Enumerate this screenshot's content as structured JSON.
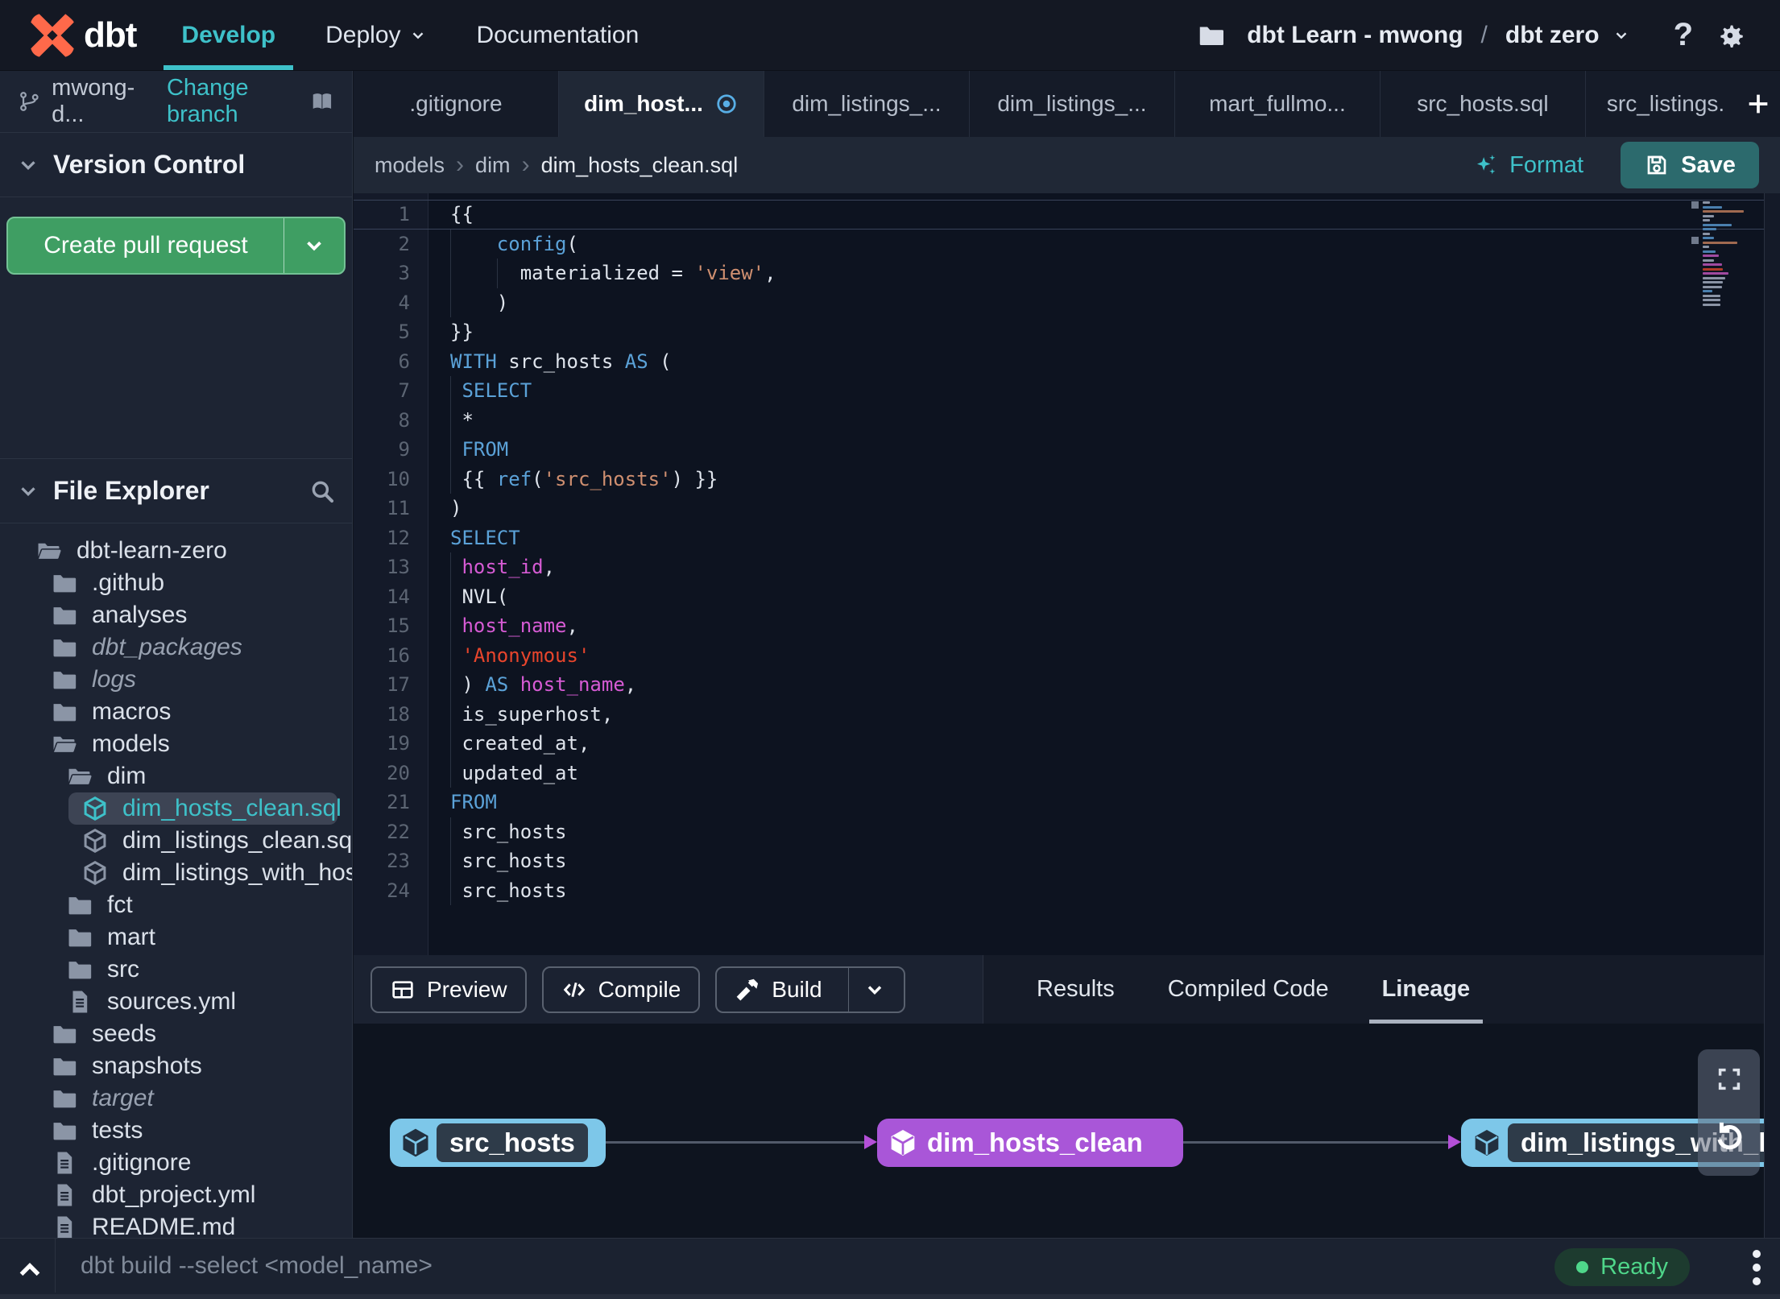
{
  "colors": {
    "bg_nav": "#141823",
    "bg_side": "#1d2433",
    "bg_tabrow": "#151b28",
    "bg_tab_active": "#202836",
    "bg_editor": "#0d1320",
    "bg_gutter": "#141a29",
    "bg_toolbar_left": "#1b2231",
    "bg_toolbar_right": "#151b28",
    "bg_lineage": "#0e141f",
    "bg_status": "#1b2230",
    "border": "#2b3342",
    "teal": "#3ec1c9",
    "green": "#3f9e63",
    "green_border": "#74c295",
    "save": "#2c6a6d",
    "purple": "#a956d8",
    "nodeblue": "#7dc7e9",
    "ready": "#4fd68a",
    "readybg": "#1d3b2f",
    "brand_orange": "#ff694a",
    "blue_dot": "#58aee5",
    "code_keyword": "#5ba2d8",
    "code_ident": "#d65bd4",
    "code_string": "#cf8f70",
    "code_red": "#e8452c",
    "code_text": "#dfe4ec",
    "code_linenum": "#5c6573"
  },
  "nav": {
    "brand": "dbt",
    "items": [
      {
        "label": "Develop",
        "active": true,
        "chevron": false
      },
      {
        "label": "Deploy",
        "active": false,
        "chevron": true
      },
      {
        "label": "Documentation",
        "active": false,
        "chevron": false
      }
    ],
    "project": {
      "folder_label": "dbt Learn - mwong",
      "separator": "/",
      "env_label": "dbt zero"
    },
    "help_label": "?"
  },
  "sidebar": {
    "branch": {
      "name": "mwong-d...",
      "change_link": "Change branch"
    },
    "version_control": {
      "title": "Version Control",
      "pr_button": "Create pull request"
    },
    "file_explorer": {
      "title": "File Explorer",
      "tree": [
        {
          "label": "dbt-learn-zero",
          "level": 0,
          "icon": "folder-open-icon"
        },
        {
          "label": ".github",
          "level": 1,
          "icon": "folder-icon"
        },
        {
          "label": "analyses",
          "level": 1,
          "icon": "folder-icon"
        },
        {
          "label": "dbt_packages",
          "level": 1,
          "icon": "folder-icon",
          "italic": true
        },
        {
          "label": "logs",
          "level": 1,
          "icon": "folder-icon",
          "italic": true
        },
        {
          "label": "macros",
          "level": 1,
          "icon": "folder-icon"
        },
        {
          "label": "models",
          "level": 1,
          "icon": "folder-open-icon"
        },
        {
          "label": "dim",
          "level": 2,
          "icon": "folder-open-icon"
        },
        {
          "label": "dim_hosts_clean.sql",
          "level": 3,
          "icon": "model-icon",
          "selected": true,
          "modified_dot": true
        },
        {
          "label": "dim_listings_clean.sql",
          "level": 3,
          "icon": "model-icon"
        },
        {
          "label": "dim_listings_with_hosts...",
          "level": 3,
          "icon": "model-icon"
        },
        {
          "label": "fct",
          "level": 2,
          "icon": "folder-icon"
        },
        {
          "label": "mart",
          "level": 2,
          "icon": "folder-icon"
        },
        {
          "label": "src",
          "level": 2,
          "icon": "folder-icon"
        },
        {
          "label": "sources.yml",
          "level": 2,
          "icon": "file-icon"
        },
        {
          "label": "seeds",
          "level": 1,
          "icon": "folder-icon"
        },
        {
          "label": "snapshots",
          "level": 1,
          "icon": "folder-icon"
        },
        {
          "label": "target",
          "level": 1,
          "icon": "folder-icon",
          "italic": true
        },
        {
          "label": "tests",
          "level": 1,
          "icon": "folder-icon"
        },
        {
          "label": ".gitignore",
          "level": 1,
          "icon": "file-icon"
        },
        {
          "label": "dbt_project.yml",
          "level": 1,
          "icon": "file-icon"
        },
        {
          "label": "README.md",
          "level": 1,
          "icon": "file-icon"
        }
      ]
    }
  },
  "tabs": {
    "items": [
      {
        "label": ".gitignore"
      },
      {
        "label": "dim_host...",
        "active": true,
        "modified": true
      },
      {
        "label": "dim_listings_..."
      },
      {
        "label": "dim_listings_..."
      },
      {
        "label": "mart_fullmo..."
      },
      {
        "label": "src_hosts.sql"
      },
      {
        "label": "src_listings.",
        "clipped": true
      }
    ],
    "add_button": "+"
  },
  "breadcrumb": {
    "segments": [
      "models",
      "dim",
      "dim_hosts_clean.sql"
    ]
  },
  "editor_actions": {
    "format": "Format",
    "save": "Save"
  },
  "editor": {
    "lines": [
      {
        "n": 1,
        "active": true,
        "guides": [],
        "segs": [
          [
            "{{",
            "w"
          ]
        ]
      },
      {
        "n": 2,
        "guides": [
          0
        ],
        "segs": [
          [
            "    ",
            "w"
          ],
          [
            "config",
            "k"
          ],
          [
            "(",
            "w"
          ]
        ]
      },
      {
        "n": 3,
        "guides": [
          0,
          4
        ],
        "segs": [
          [
            "      materialized = ",
            "w"
          ],
          [
            "'view'",
            "s"
          ],
          [
            ",",
            "w"
          ]
        ]
      },
      {
        "n": 4,
        "guides": [
          0
        ],
        "segs": [
          [
            "    )",
            "w"
          ]
        ]
      },
      {
        "n": 5,
        "guides": [],
        "segs": [
          [
            "}}",
            "w"
          ]
        ]
      },
      {
        "n": 6,
        "guides": [],
        "segs": [
          [
            "WITH",
            "k"
          ],
          [
            " src_hosts ",
            "w"
          ],
          [
            "AS",
            "k"
          ],
          [
            " (",
            "w"
          ]
        ]
      },
      {
        "n": 7,
        "guides": [
          0
        ],
        "segs": [
          [
            " ",
            "w"
          ],
          [
            "SELECT",
            "k"
          ]
        ]
      },
      {
        "n": 8,
        "guides": [
          0
        ],
        "segs": [
          [
            " *",
            "w"
          ]
        ]
      },
      {
        "n": 9,
        "guides": [
          0
        ],
        "segs": [
          [
            " ",
            "w"
          ],
          [
            "FROM",
            "k"
          ]
        ]
      },
      {
        "n": 10,
        "guides": [
          0
        ],
        "segs": [
          [
            " {{ ",
            "w"
          ],
          [
            "ref",
            "k"
          ],
          [
            "(",
            "w"
          ],
          [
            "'src_hosts'",
            "s"
          ],
          [
            ") }}",
            "w"
          ]
        ]
      },
      {
        "n": 11,
        "guides": [],
        "segs": [
          [
            ")",
            "w"
          ]
        ]
      },
      {
        "n": 12,
        "guides": [],
        "segs": [
          [
            "SELECT",
            "k"
          ]
        ]
      },
      {
        "n": 13,
        "guides": [
          0
        ],
        "segs": [
          [
            " ",
            "w"
          ],
          [
            "host_id",
            "m"
          ],
          [
            ",",
            "w"
          ]
        ]
      },
      {
        "n": 14,
        "guides": [
          0
        ],
        "segs": [
          [
            " NVL(",
            "w"
          ]
        ]
      },
      {
        "n": 15,
        "guides": [
          0
        ],
        "segs": [
          [
            " ",
            "w"
          ],
          [
            "host_name",
            "m"
          ],
          [
            ",",
            "w"
          ]
        ]
      },
      {
        "n": 16,
        "guides": [
          0
        ],
        "segs": [
          [
            " ",
            "w"
          ],
          [
            "'Anonymous'",
            "r"
          ]
        ]
      },
      {
        "n": 17,
        "guides": [
          0
        ],
        "segs": [
          [
            " ) ",
            "w"
          ],
          [
            "AS",
            "k"
          ],
          [
            " ",
            "w"
          ],
          [
            "host_name",
            "m"
          ],
          [
            ",",
            "w"
          ]
        ]
      },
      {
        "n": 18,
        "guides": [
          0
        ],
        "segs": [
          [
            " is_superhost,",
            "w"
          ]
        ]
      },
      {
        "n": 19,
        "guides": [
          0
        ],
        "segs": [
          [
            " created_at,",
            "w"
          ]
        ]
      },
      {
        "n": 20,
        "guides": [
          0
        ],
        "segs": [
          [
            " updated_at",
            "w"
          ]
        ]
      },
      {
        "n": 21,
        "guides": [],
        "segs": [
          [
            "FROM",
            "k"
          ]
        ]
      },
      {
        "n": 22,
        "guides": [
          0
        ],
        "segs": [
          [
            " src_hosts",
            "w"
          ]
        ]
      },
      {
        "n": 23,
        "guides": [
          0
        ],
        "segs": [
          [
            " src_hosts",
            "w"
          ]
        ]
      },
      {
        "n": 24,
        "guides": [
          0
        ],
        "segs": [
          [
            " src_hosts",
            "w"
          ]
        ]
      }
    ]
  },
  "toolbar": {
    "buttons": [
      {
        "label": "Preview",
        "icon": "table-icon"
      },
      {
        "label": "Compile",
        "icon": "code-icon"
      },
      {
        "label": "Build",
        "icon": "hammer-icon",
        "split": true
      }
    ],
    "tabs": [
      {
        "label": "Results"
      },
      {
        "label": "Compiled Code"
      },
      {
        "label": "Lineage",
        "active": true
      }
    ]
  },
  "lineage": {
    "nodes": [
      {
        "label": "src_hosts",
        "type": "source"
      },
      {
        "label": "dim_hosts_clean",
        "type": "model"
      },
      {
        "label": "dim_listings_with_h",
        "type": "source"
      }
    ]
  },
  "statusbar": {
    "command_placeholder": "dbt build --select <model_name>",
    "status": "Ready"
  }
}
